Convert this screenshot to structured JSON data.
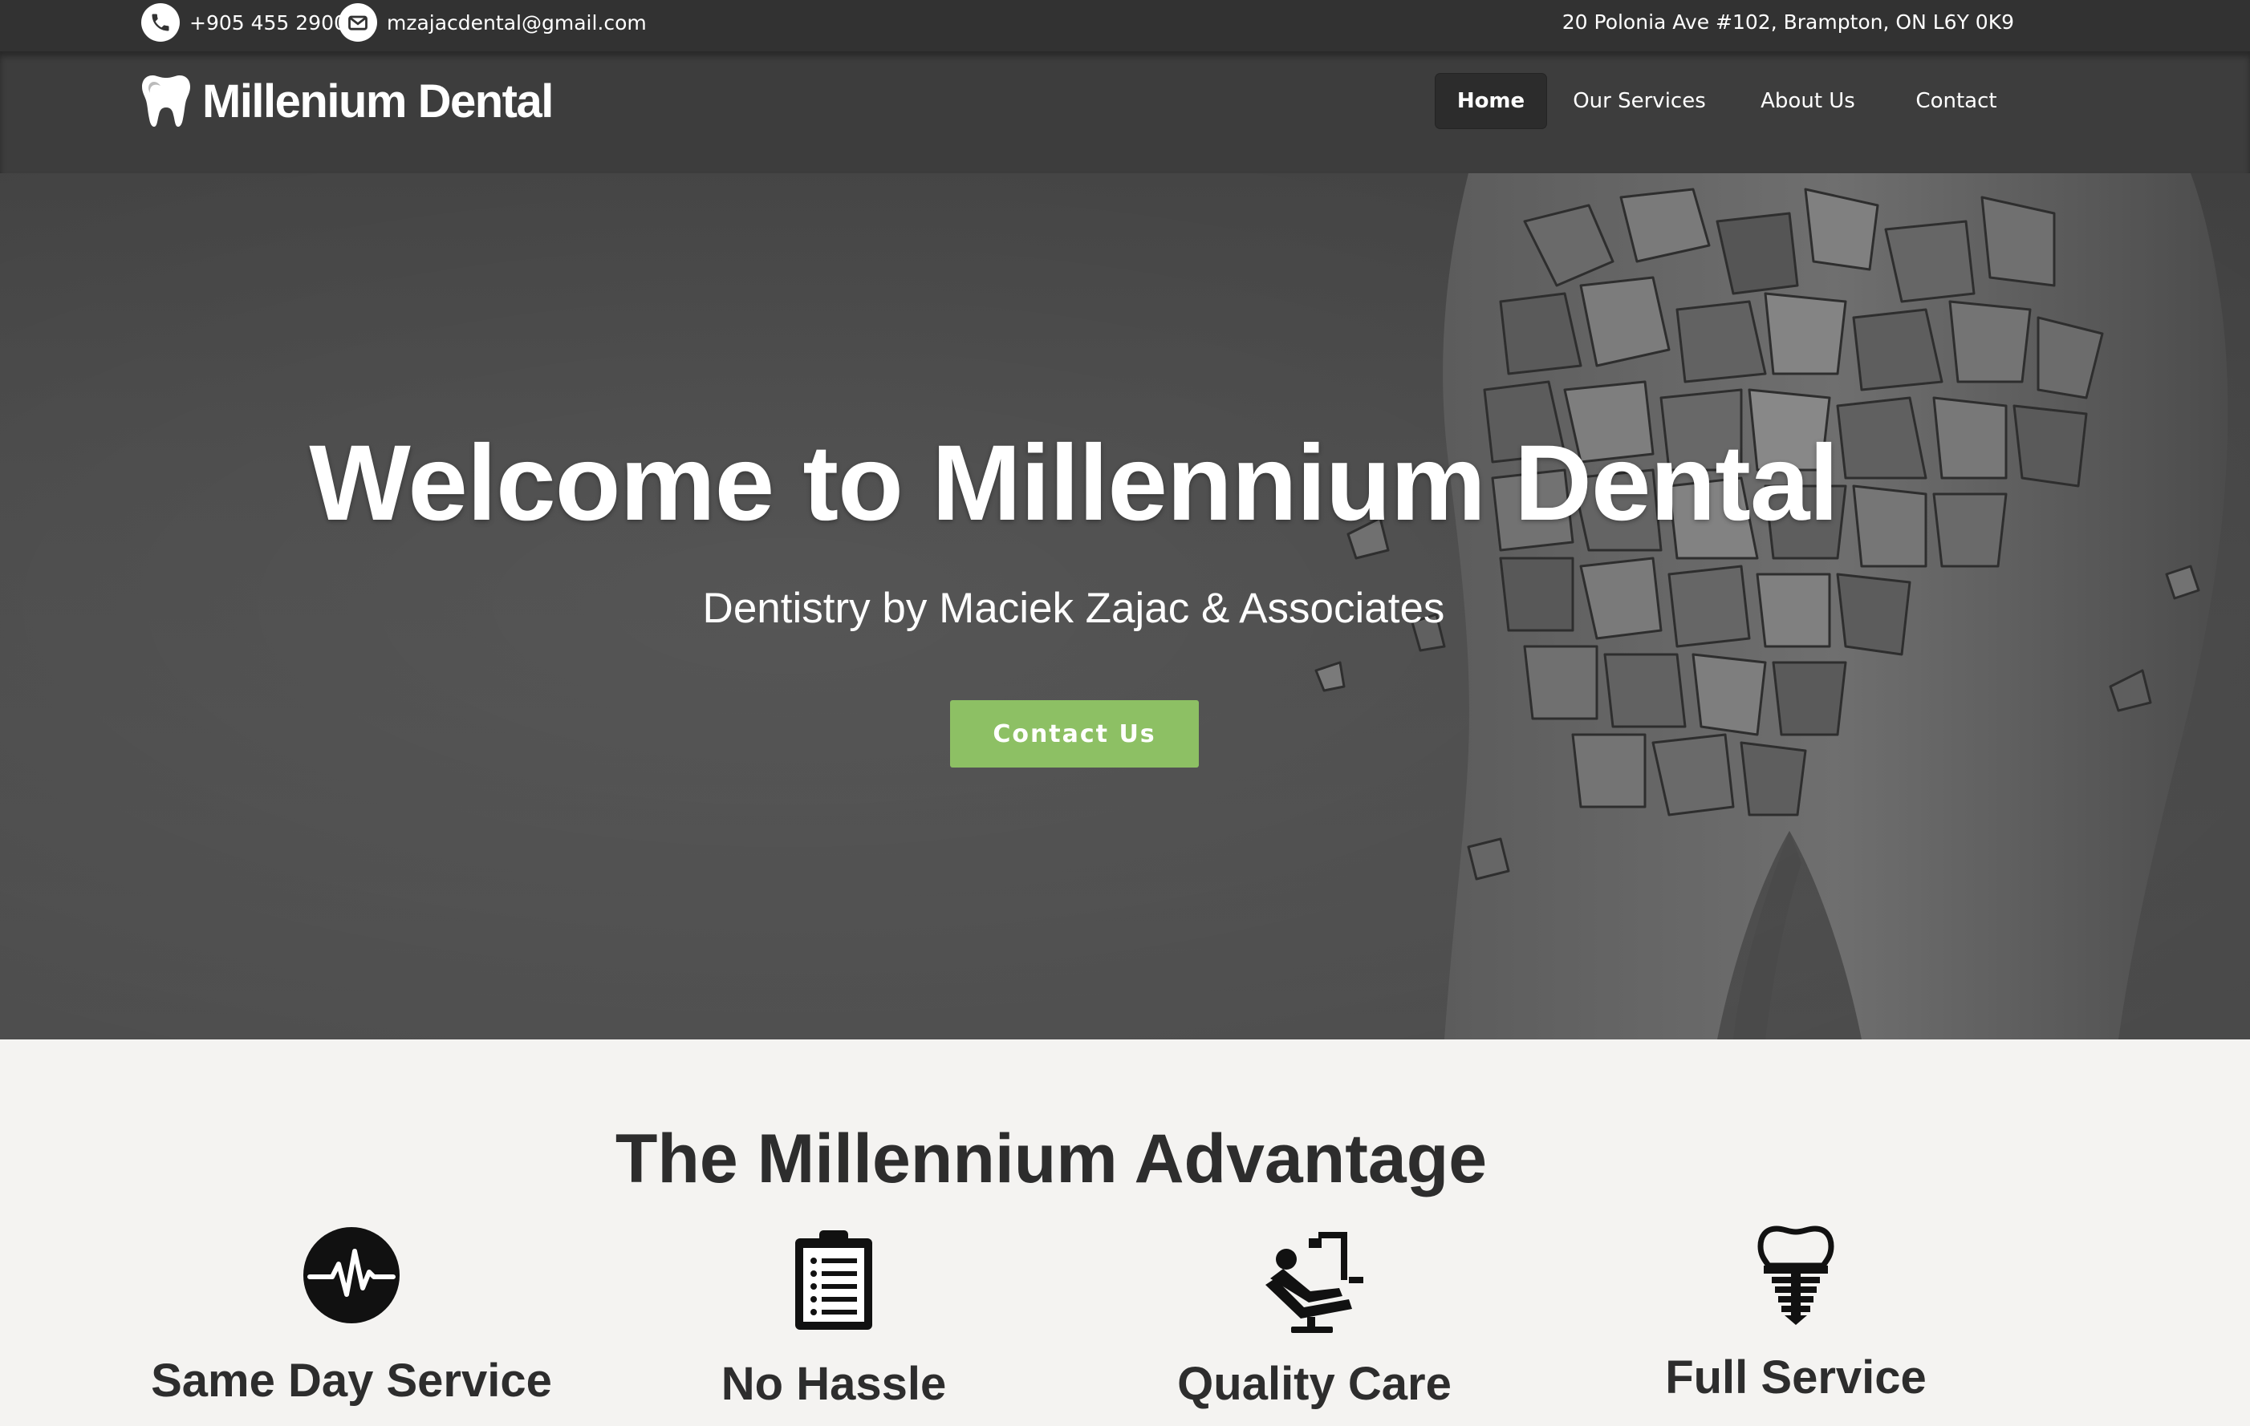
{
  "topbar": {
    "phone": "+905 455 2900",
    "email": "mzajacdental@gmail.com",
    "address": "20 Polonia Ave #102, Brampton, ON L6Y 0K9",
    "icons": [
      "phone-icon",
      "envelope-icon"
    ]
  },
  "header": {
    "brand": "Millenium Dental",
    "logo_icon": "tooth-icon",
    "nav": {
      "home": "Home",
      "services": "Our Services",
      "about": "About Us",
      "contact": "Contact"
    },
    "active": "Home"
  },
  "hero": {
    "title": "Welcome to Millennium Dental",
    "subtitle": "Dentistry by Maciek Zajac & Associates",
    "cta": "Contact Us",
    "cta_color": "#8dc064"
  },
  "advantage": {
    "heading": "The Millennium Advantage",
    "features": [
      {
        "title": "Same Day Service",
        "icon": "heartbeat-icon"
      },
      {
        "title": "No Hassle",
        "icon": "clipboard-icon"
      },
      {
        "title": "Quality Care",
        "icon": "dental-chair-icon"
      },
      {
        "title": "Full Service",
        "icon": "dental-implant-icon"
      }
    ]
  },
  "colors": {
    "topbar": "#323232",
    "header": "#3d3d3d",
    "hero": "#545454",
    "section_bg": "#f4f3f1",
    "text_dark": "#2d2d2d"
  }
}
